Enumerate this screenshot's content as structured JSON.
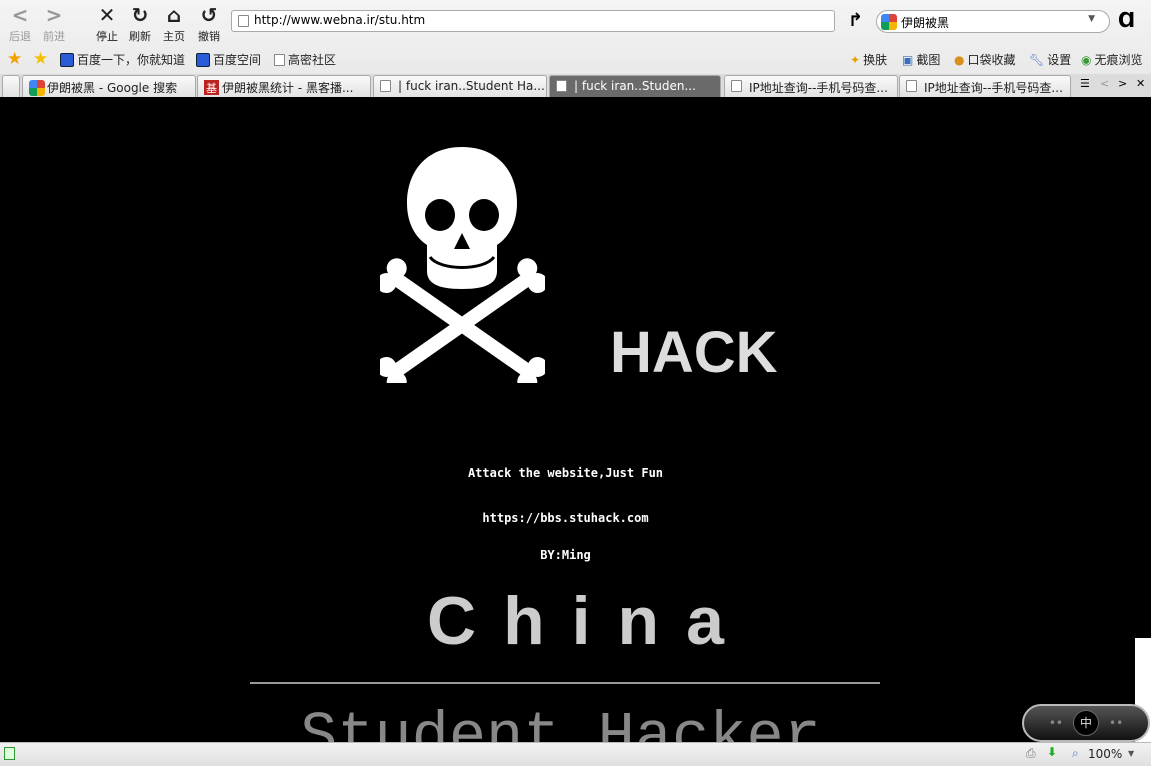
{
  "toolbar": {
    "back": "后退",
    "forward": "前进",
    "stop": "停止",
    "refresh": "刷新",
    "home": "主页",
    "undo": "撤销"
  },
  "address": {
    "url": "http://www.webna.ir/stu.htm"
  },
  "search": {
    "value": "伊朗被黑"
  },
  "bookmarks": [
    "百度一下，你就知道",
    "百度空间",
    "高密社区"
  ],
  "tools": [
    "换肤",
    "截图",
    "口袋收藏",
    "设置",
    "无痕浏览"
  ],
  "tabs": [
    {
      "label": "伊朗被黑 - Google 搜索",
      "icon": "google-icon"
    },
    {
      "label": "伊朗被黑统计 - 黑客播...",
      "icon": "site-icon"
    },
    {
      "label": "| fuck iran..Student Ha...",
      "icon": "page-icon"
    },
    {
      "label": "| fuck iran..Studen...",
      "icon": "page-icon",
      "active": true
    },
    {
      "label": "IP地址查询--手机号码查...",
      "icon": "page-icon"
    },
    {
      "label": "IP地址查询--手机号码查...",
      "icon": "page-icon"
    }
  ],
  "page": {
    "hack": "HACK",
    "line1": "Attack the website,Just Fun",
    "line2": "https://bbs.stuhack.com",
    "line3": "BY:Ming",
    "china": "China",
    "footer": "Student Hacker"
  },
  "status": {
    "zoom": "100%"
  },
  "ime": {
    "label": "中"
  }
}
